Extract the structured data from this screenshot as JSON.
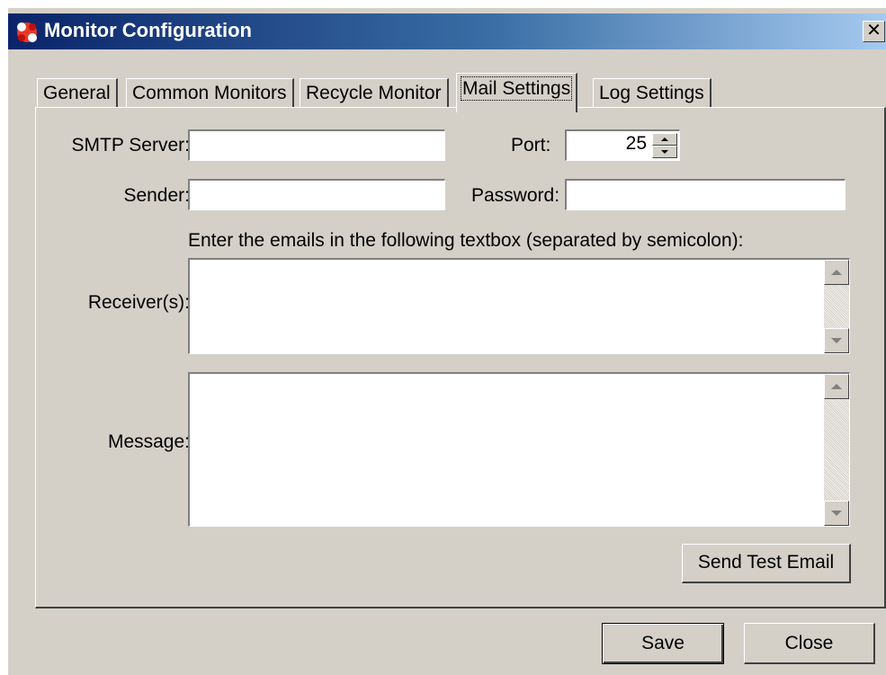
{
  "window": {
    "title": "Monitor Configuration",
    "close_glyph": "✕"
  },
  "icons": {
    "app": "app-icon",
    "close": "close-icon"
  },
  "tabs": [
    {
      "label": "General",
      "active": false
    },
    {
      "label": "Common Monitors",
      "active": false
    },
    {
      "label": "Recycle Monitor",
      "active": false
    },
    {
      "label": "Mail Settings",
      "active": true
    },
    {
      "label": "Log Settings",
      "active": false
    }
  ],
  "mail": {
    "smtp_label": "SMTP Server:",
    "smtp_value": "",
    "port_label": "Port:",
    "port_value": "25",
    "sender_label": "Sender:",
    "sender_value": "",
    "password_label": "Password:",
    "password_value": "",
    "instructions": "Enter the emails in the following textbox (separated by semicolon):",
    "receivers_label": "Receiver(s):",
    "receivers_value": "",
    "message_label": "Message:",
    "message_value": "",
    "send_test_label": "Send Test Email"
  },
  "footer": {
    "save_label": "Save",
    "close_label": "Close"
  },
  "colors": {
    "face": "#d4d0c8",
    "title_start": "#0a246a",
    "title_end": "#a6caf0"
  }
}
